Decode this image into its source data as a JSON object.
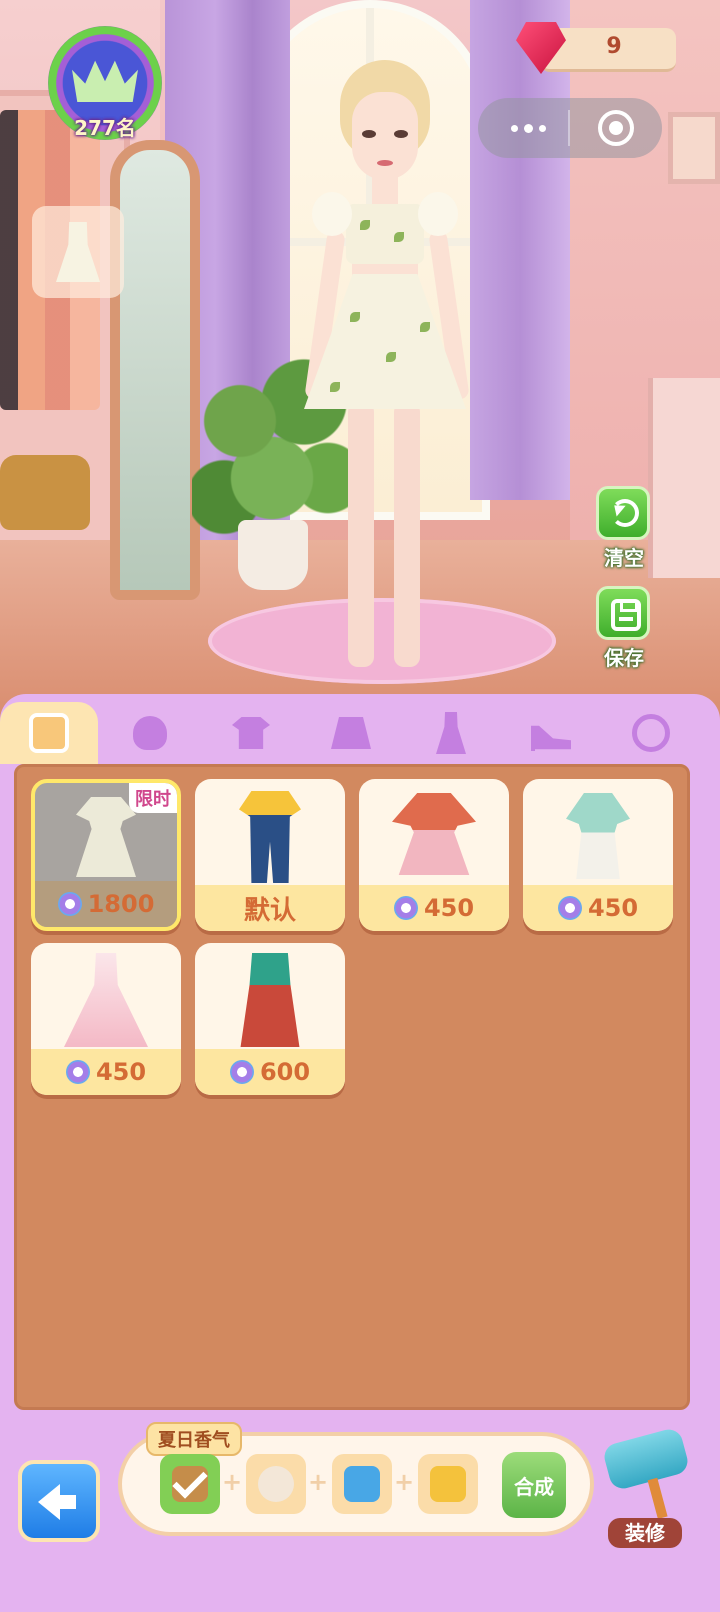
{
  "hud": {
    "rank_label": "277名",
    "gem_count": "9"
  },
  "side_buttons": {
    "clear_label": "清空",
    "save_label": "保存"
  },
  "tabs": [
    {
      "icon": "outfit-icon",
      "active": true
    },
    {
      "icon": "hair-icon",
      "active": false
    },
    {
      "icon": "top-icon",
      "active": false
    },
    {
      "icon": "skirt-icon",
      "active": false
    },
    {
      "icon": "dress-icon",
      "active": false
    },
    {
      "icon": "shoe-icon",
      "active": false
    },
    {
      "icon": "accessory-icon",
      "active": false
    }
  ],
  "items": [
    {
      "price": "1800",
      "tag": "限时",
      "selected": true
    },
    {
      "label": "默认"
    },
    {
      "price": "450"
    },
    {
      "price": "450"
    },
    {
      "price": "450"
    },
    {
      "price": "600"
    }
  ],
  "synthesis": {
    "title": "夏日香气",
    "compose_label": "合成"
  },
  "decorate_label": "装修",
  "colors": {
    "panel": "#e4b3f0",
    "grid_bg": "#d2895f",
    "price_text": "#d46b35",
    "action_green": "#5cb447",
    "back_blue": "#1f7de6"
  }
}
